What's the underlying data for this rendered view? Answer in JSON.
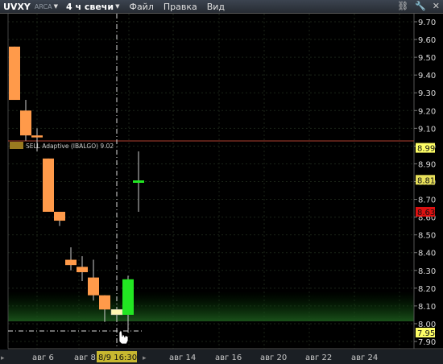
{
  "toolbar": {
    "symbol": "UVXY",
    "exchange": "ARCA",
    "period": "4 ч свечи",
    "menu_file": "Файл",
    "menu_edit": "Правка",
    "menu_view": "Вид",
    "icon_link": "link-chain-icon",
    "icon_tools": "wrench-icon",
    "icon_close": "close-icon"
  },
  "order_line": {
    "label": "SELL Adaptive (IBALGO) 9.02",
    "price_tag": "8.99",
    "color": "#c04030"
  },
  "price_tags": [
    {
      "value": "8.99",
      "bg": "#ffff66"
    },
    {
      "value": "8.81",
      "bg": "#e8e05a"
    },
    {
      "value": "8.63",
      "bg": "#dd1111"
    },
    {
      "value": "7.95",
      "bg": "#ffff66"
    }
  ],
  "cursor": {
    "time_label": "8/9 16:30"
  },
  "chart_data": {
    "type": "candlestick",
    "ylim": [
      7.85,
      9.75
    ],
    "y_ticks": [
      "9.70",
      "9.60",
      "9.50",
      "9.40",
      "9.30",
      "9.20",
      "9.10",
      "9.00",
      "8.90",
      "8.80",
      "8.70",
      "8.60",
      "8.50",
      "8.40",
      "8.30",
      "8.20",
      "8.10",
      "8.00",
      "7.90"
    ],
    "x_ticks": [
      "авг 6",
      "авг 8",
      "авг 14",
      "авг 16",
      "авг 20",
      "авг 22",
      "авг 24"
    ],
    "candles": [
      {
        "open": 9.56,
        "high": 9.56,
        "low": 9.26,
        "close": 9.26,
        "color": "orange"
      },
      {
        "open": 9.2,
        "high": 9.26,
        "low": 9.03,
        "close": 9.06,
        "color": "orange"
      },
      {
        "open": 9.06,
        "high": 9.1,
        "low": 8.97,
        "close": 9.05,
        "color": "orange"
      },
      {
        "open": 8.93,
        "high": 8.93,
        "low": 8.63,
        "close": 8.63,
        "color": "orange"
      },
      {
        "open": 8.63,
        "high": 8.63,
        "low": 8.55,
        "close": 8.58,
        "color": "orange"
      },
      {
        "open": 8.36,
        "high": 8.43,
        "low": 8.3,
        "close": 8.33,
        "color": "orange"
      },
      {
        "open": 8.32,
        "high": 8.38,
        "low": 8.24,
        "close": 8.29,
        "color": "orange"
      },
      {
        "open": 8.26,
        "high": 8.36,
        "low": 8.13,
        "close": 8.16,
        "color": "orange"
      },
      {
        "open": 8.16,
        "high": 8.16,
        "low": 8.01,
        "close": 8.08,
        "color": "orange"
      },
      {
        "open": 8.08,
        "high": 8.08,
        "low": 8.01,
        "close": 8.05,
        "color": "yellow"
      },
      {
        "open": 8.05,
        "high": 8.27,
        "low": 7.95,
        "close": 8.25,
        "color": "green"
      },
      {
        "open": 8.8,
        "high": 8.97,
        "low": 8.63,
        "close": 8.8,
        "color": "green-tick"
      }
    ],
    "grid": true
  }
}
